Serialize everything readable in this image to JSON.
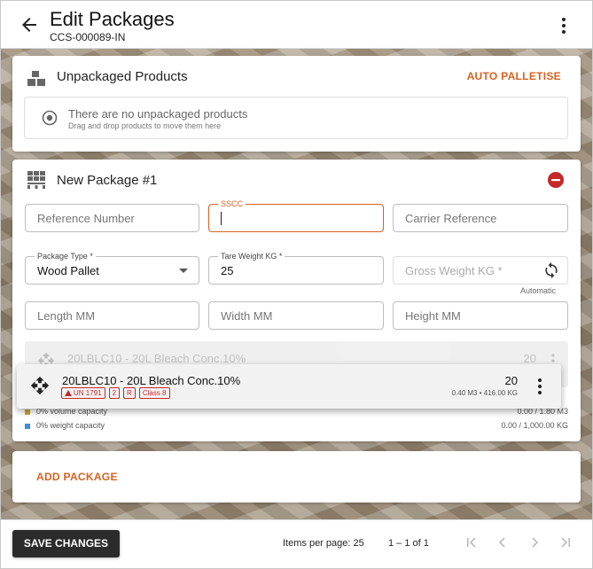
{
  "header": {
    "title": "Edit Packages",
    "subtitle": "CCS-000089-IN"
  },
  "unpackaged": {
    "title": "Unpackaged Products",
    "action_label": "AUTO PALLETISE",
    "empty_title": "There are no unpackaged products",
    "empty_sub": "Drag and drop products to move them here"
  },
  "package": {
    "title": "New Package #1",
    "fields": {
      "reference": {
        "placeholder": "Reference Number"
      },
      "sscc": {
        "label": "SSCC",
        "value": ""
      },
      "carrier": {
        "placeholder": "Carrier Reference"
      },
      "package_type": {
        "label": "Package Type *",
        "value": "Wood Pallet"
      },
      "tare_weight": {
        "label": "Tare Weight KG *",
        "value": "25"
      },
      "gross_weight": {
        "placeholder": "Gross Weight KG *",
        "note": "Automatic"
      },
      "length": {
        "placeholder": "Length MM"
      },
      "width": {
        "placeholder": "Width MM"
      },
      "height": {
        "placeholder": "Height MM"
      }
    },
    "ghost_item": {
      "name": "20LBLC10 - 20L Bleach Conc.10%",
      "qty": "20"
    },
    "capacity": [
      {
        "label": "0% volume capacity",
        "value": "0.00 / 1.80 M3",
        "color": "#c9a227"
      },
      {
        "label": "0% weight capacity",
        "value": "0.00 / 1,000.00 KG",
        "color": "#3a8fd9"
      }
    ]
  },
  "dragged_item": {
    "name": "20LBLC10 - 20L Bleach Conc.10%",
    "badges": [
      "UN 1791",
      "2",
      "R",
      "Class 8"
    ],
    "qty": "20",
    "meta": "0.40 M3 • 416.00 KG"
  },
  "add_package_label": "ADD PACKAGE",
  "footer": {
    "save_label": "SAVE CHANGES",
    "items_per_page": "Items per page: 25",
    "range": "1 – 1 of 1"
  },
  "colors": {
    "accent": "#d7611f",
    "danger": "#c62828"
  }
}
